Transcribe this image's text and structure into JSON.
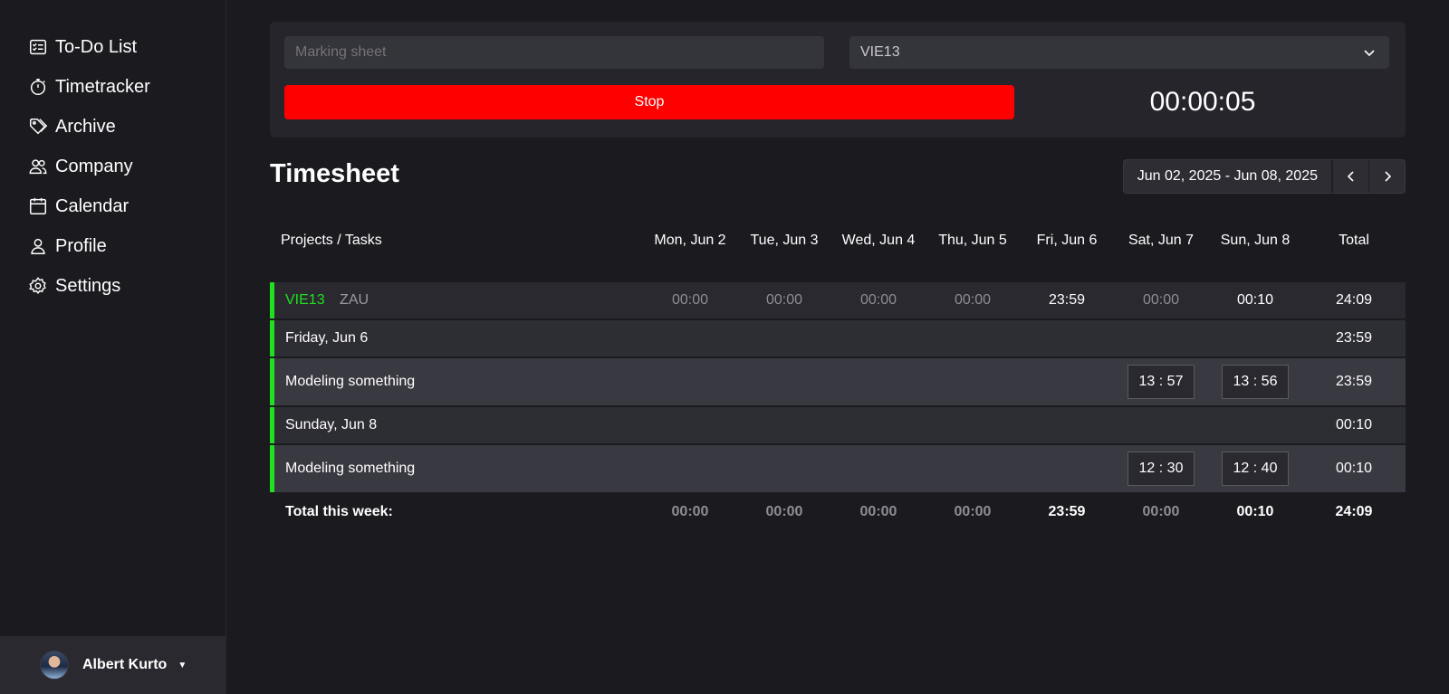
{
  "sidebar": {
    "items": [
      {
        "label": "To-Do List",
        "icon": "checklist-icon"
      },
      {
        "label": "Timetracker",
        "icon": "stopwatch-icon"
      },
      {
        "label": "Archive",
        "icon": "tag-icon"
      },
      {
        "label": "Company",
        "icon": "users-icon"
      },
      {
        "label": "Calendar",
        "icon": "calendar-icon"
      },
      {
        "label": "Profile",
        "icon": "user-icon"
      },
      {
        "label": "Settings",
        "icon": "gear-icon"
      }
    ],
    "user": {
      "name": "Albert Kurto"
    }
  },
  "tracker": {
    "task_placeholder": "Marking sheet",
    "project_selected": "VIE13",
    "stop_label": "Stop",
    "stop_color": "#ff0000",
    "elapsed": "00:00:05"
  },
  "timesheet": {
    "title": "Timesheet",
    "date_range": "Jun 02, 2025 - Jun 08, 2025",
    "columns": [
      "Projects / Tasks",
      "Mon, Jun 2",
      "Tue, Jun 3",
      "Wed, Jun 4",
      "Thu, Jun 5",
      "Fri, Jun 6",
      "Sat, Jun 7",
      "Sun, Jun 8",
      "Total"
    ],
    "project_row": {
      "code": "VIE13",
      "client": "ZAU",
      "days": [
        "00:00",
        "00:00",
        "00:00",
        "00:00",
        "23:59",
        "00:00",
        "00:10"
      ],
      "total": "24:09",
      "accent": "#20e020"
    },
    "groups": [
      {
        "day_label": "Friday, Jun 6",
        "day_total": "23:59",
        "task": {
          "name": "Modeling something",
          "start": "13 : 57",
          "end": "13 : 56",
          "total": "23:59"
        }
      },
      {
        "day_label": "Sunday, Jun 8",
        "day_total": "00:10",
        "task": {
          "name": "Modeling something",
          "start": "12 : 30",
          "end": "12 : 40",
          "total": "00:10"
        }
      }
    ],
    "week_total": {
      "label": "Total this week:",
      "days": [
        "00:00",
        "00:00",
        "00:00",
        "00:00",
        "23:59",
        "00:00",
        "00:10"
      ],
      "total": "24:09"
    }
  }
}
